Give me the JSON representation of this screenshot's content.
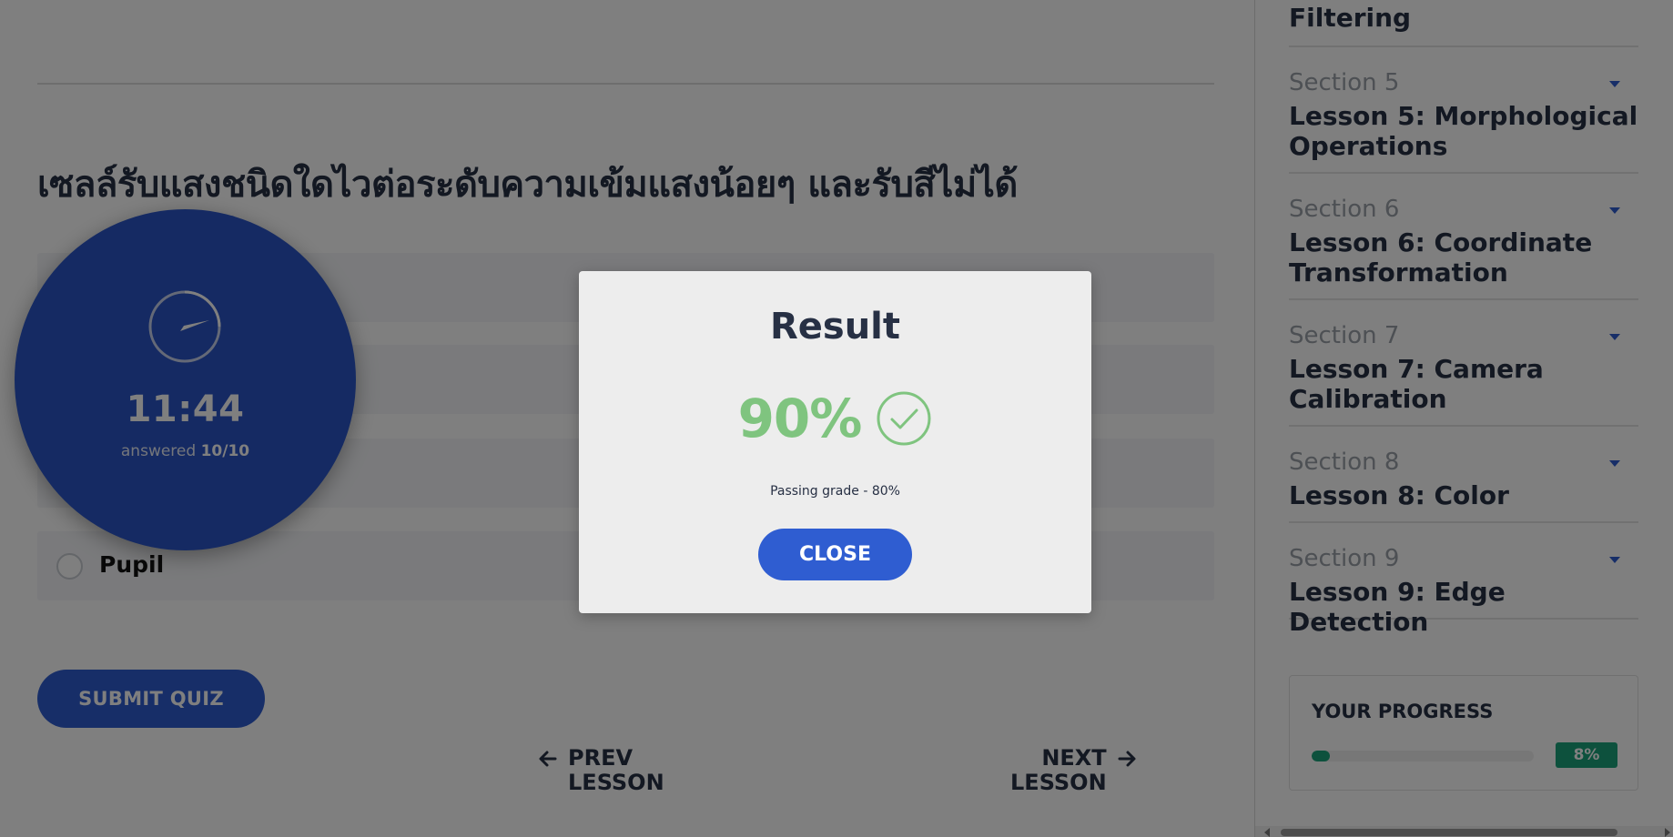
{
  "quiz": {
    "question": "เซลล์รับแสงชนิดใดไวต่อระดับความเข้มแสงน้อยๆ และรับสีไม่ได้",
    "options": [
      {
        "label": ""
      },
      {
        "label": ""
      },
      {
        "label": ""
      },
      {
        "label": "Pupil"
      }
    ],
    "submit_label": "SUBMIT QUIZ"
  },
  "timer": {
    "time": "11:44",
    "answered_prefix": "answered",
    "answered_count": "10/10"
  },
  "nav": {
    "prev_line1": "PREV",
    "prev_line2": "LESSON",
    "next_line1": "NEXT",
    "next_line2": "LESSON"
  },
  "sidebar": {
    "prev_lesson_tail": "Filtering",
    "sections": [
      {
        "section": "Section 5",
        "lesson_line1": "Lesson 5: Morphological",
        "lesson_line2": "Operations"
      },
      {
        "section": "Section 6",
        "lesson_line1": "Lesson 6: Coordinate",
        "lesson_line2": "Transformation"
      },
      {
        "section": "Section 7",
        "lesson_line1": "Lesson 7: Camera",
        "lesson_line2": "Calibration"
      },
      {
        "section": "Section 8",
        "lesson_line1": "Lesson 8: Color",
        "lesson_line2": ""
      },
      {
        "section": "Section 9",
        "lesson_line1": "Lesson 9: Edge Detection",
        "lesson_line2": ""
      }
    ],
    "progress": {
      "title": "YOUR PROGRESS",
      "value_text": "8%",
      "fraction": 0.08
    }
  },
  "modal": {
    "title": "Result",
    "score": "90%",
    "passing_text": "Passing grade - 80%",
    "close_label": "CLOSE"
  },
  "colors": {
    "accent": "#2f5dd1",
    "success": "#7fc47f",
    "progress": "#1aa37a",
    "text": "#273044"
  }
}
